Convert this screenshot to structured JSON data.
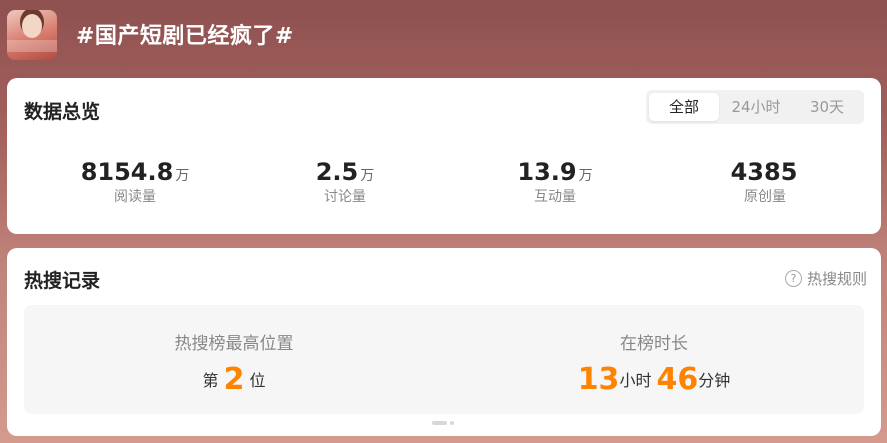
{
  "header": {
    "title": "#国产短剧已经疯了#",
    "thumbnail_icon": "drama-poster-thumbnail"
  },
  "overview": {
    "title": "数据总览",
    "tabs": [
      {
        "label": "全部",
        "active": true
      },
      {
        "label": "24小时",
        "active": false
      },
      {
        "label": "30天",
        "active": false
      }
    ],
    "stats": [
      {
        "value": "8154.8",
        "unit": "万",
        "label": "阅读量"
      },
      {
        "value": "2.5",
        "unit": "万",
        "label": "讨论量"
      },
      {
        "value": "13.9",
        "unit": "万",
        "label": "互动量"
      },
      {
        "value": "4385",
        "unit": "",
        "label": "原创量"
      }
    ]
  },
  "hot_search": {
    "title": "热搜记录",
    "rules_label": "热搜规则",
    "rules_icon": "question-circle-icon",
    "highest_position": {
      "caption": "热搜榜最高位置",
      "prefix": "第",
      "value": "2",
      "suffix": "位"
    },
    "duration": {
      "caption": "在榜时长",
      "hours": "13",
      "hours_unit": "小时",
      "minutes": "46",
      "minutes_unit": "分钟"
    }
  },
  "colors": {
    "accent": "#ff8200",
    "card_bg": "#ffffff",
    "panel_bg": "#f6f6f6"
  }
}
